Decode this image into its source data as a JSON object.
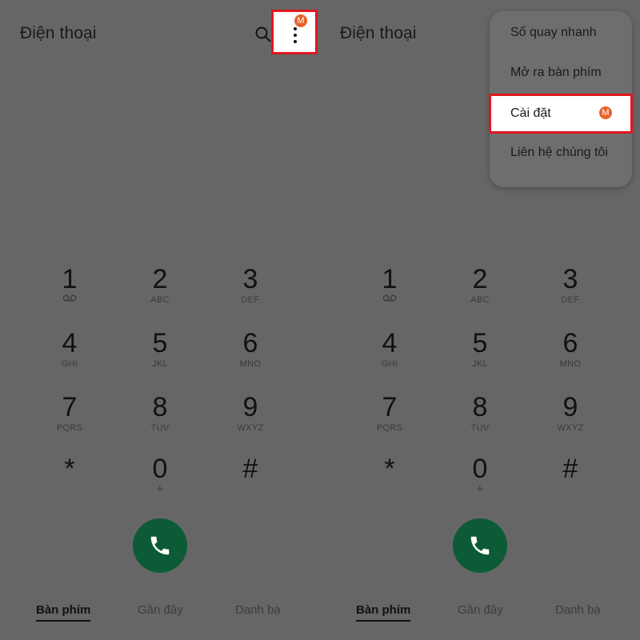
{
  "left": {
    "title": "Điện thoại",
    "menu_badge": "M"
  },
  "right": {
    "title": "Điện thoại",
    "menu": {
      "items": [
        "Số quay nhanh",
        "Mở ra bàn phím",
        "Cài đặt",
        "Liên hệ chúng tôi"
      ],
      "highlighted_badge": "M"
    }
  },
  "keypad": [
    {
      "digit": "1",
      "letters": ""
    },
    {
      "digit": "2",
      "letters": "ABC"
    },
    {
      "digit": "3",
      "letters": "DEF"
    },
    {
      "digit": "4",
      "letters": "GHI"
    },
    {
      "digit": "5",
      "letters": "JKL"
    },
    {
      "digit": "6",
      "letters": "MNO"
    },
    {
      "digit": "7",
      "letters": "PQRS"
    },
    {
      "digit": "8",
      "letters": "TUV"
    },
    {
      "digit": "9",
      "letters": "WXYZ"
    },
    {
      "digit": "*",
      "letters": ""
    },
    {
      "digit": "0",
      "letters": "+"
    },
    {
      "digit": "#",
      "letters": ""
    }
  ],
  "tabs": [
    "Bàn phím",
    "Gần đây",
    "Danh bạ"
  ],
  "colors": {
    "overlay": "#666666",
    "call_button": "#0d5a37",
    "highlight_border": "#e0161e",
    "badge": "#e8622a"
  },
  "icons": {
    "search": "search-icon",
    "more": "more-vert-icon",
    "call": "phone-icon",
    "voicemail": "voicemail-icon"
  }
}
